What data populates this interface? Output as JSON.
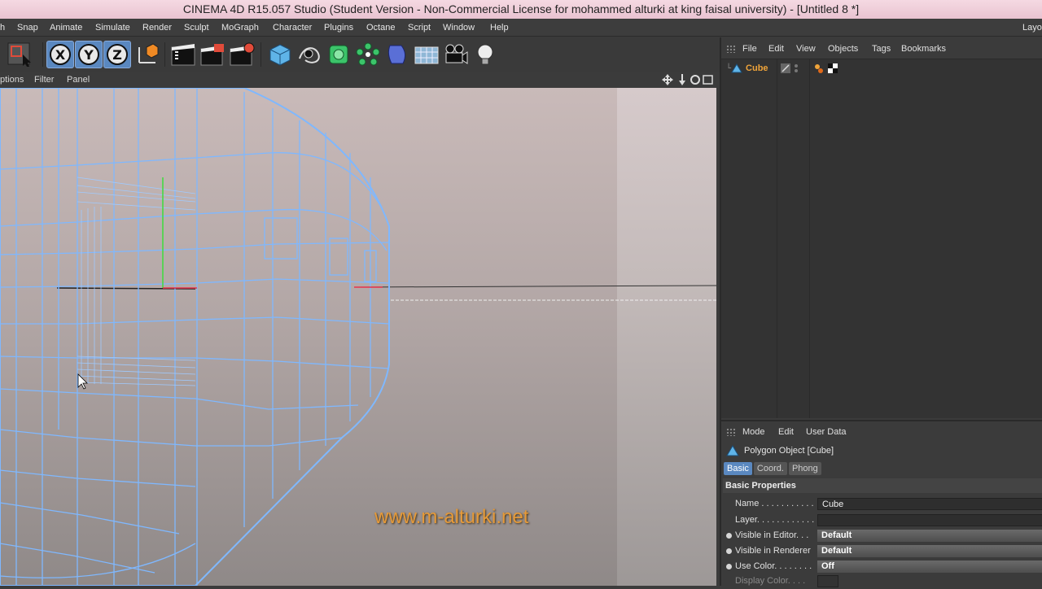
{
  "window": {
    "title": "CINEMA 4D R15.057 Studio (Student Version - Non-Commercial License for mohammed alturki at king faisal university) - [Untitled 8 *]"
  },
  "menubar": {
    "items": [
      "h",
      "Snap",
      "Animate",
      "Simulate",
      "Render",
      "Sculpt",
      "MoGraph",
      "Character",
      "Plugins",
      "Octane",
      "Script",
      "Window",
      "Help"
    ],
    "layout_label": "Layo"
  },
  "toolbar": {
    "axis_x": "X",
    "axis_y": "Y",
    "axis_z": "Z",
    "icons": [
      "render-region-icon",
      "cursor-icon",
      "coordinate-system-icon",
      "render-view-icon",
      "render-picture-viewer-icon",
      "edit-render-settings-icon",
      "cube-primitive-icon",
      "spline-pen-icon",
      "subdivision-surface-icon",
      "array-icon",
      "deformer-icon",
      "floor-icon",
      "camera-icon",
      "light-icon"
    ]
  },
  "viewport": {
    "menu": [
      "ptions",
      "Filter",
      "Panel"
    ],
    "watermark": "www.m-alturki.net"
  },
  "object_manager": {
    "menu": [
      "File",
      "Edit",
      "View",
      "Objects",
      "Tags",
      "Bookmarks"
    ],
    "objects": [
      {
        "name": "Cube",
        "icon": "polygon-object-icon"
      }
    ]
  },
  "attribute_manager": {
    "menu": [
      "Mode",
      "Edit",
      "User Data"
    ],
    "title": "Polygon Object [Cube]",
    "tabs": [
      "Basic",
      "Coord.",
      "Phong"
    ],
    "active_tab": "Basic",
    "section": "Basic Properties",
    "properties": [
      {
        "label": "Name . . . . . . . . . . .",
        "value": "Cube"
      },
      {
        "label": "Layer. . . . . . . . . . . .",
        "value": ""
      },
      {
        "label": "Visible in Editor. . .",
        "value": "Default"
      },
      {
        "label": "Visible in Renderer",
        "value": "Default"
      },
      {
        "label": "Use Color. . . . . . . .",
        "value": "Off"
      },
      {
        "label": "Display Color. . . .",
        "value": ""
      }
    ]
  },
  "colors": {
    "accent": "#5a88c0",
    "selected_object": "#f0a43a",
    "wireframe": "#7fb8ff",
    "watermark": "#e59a3a"
  }
}
